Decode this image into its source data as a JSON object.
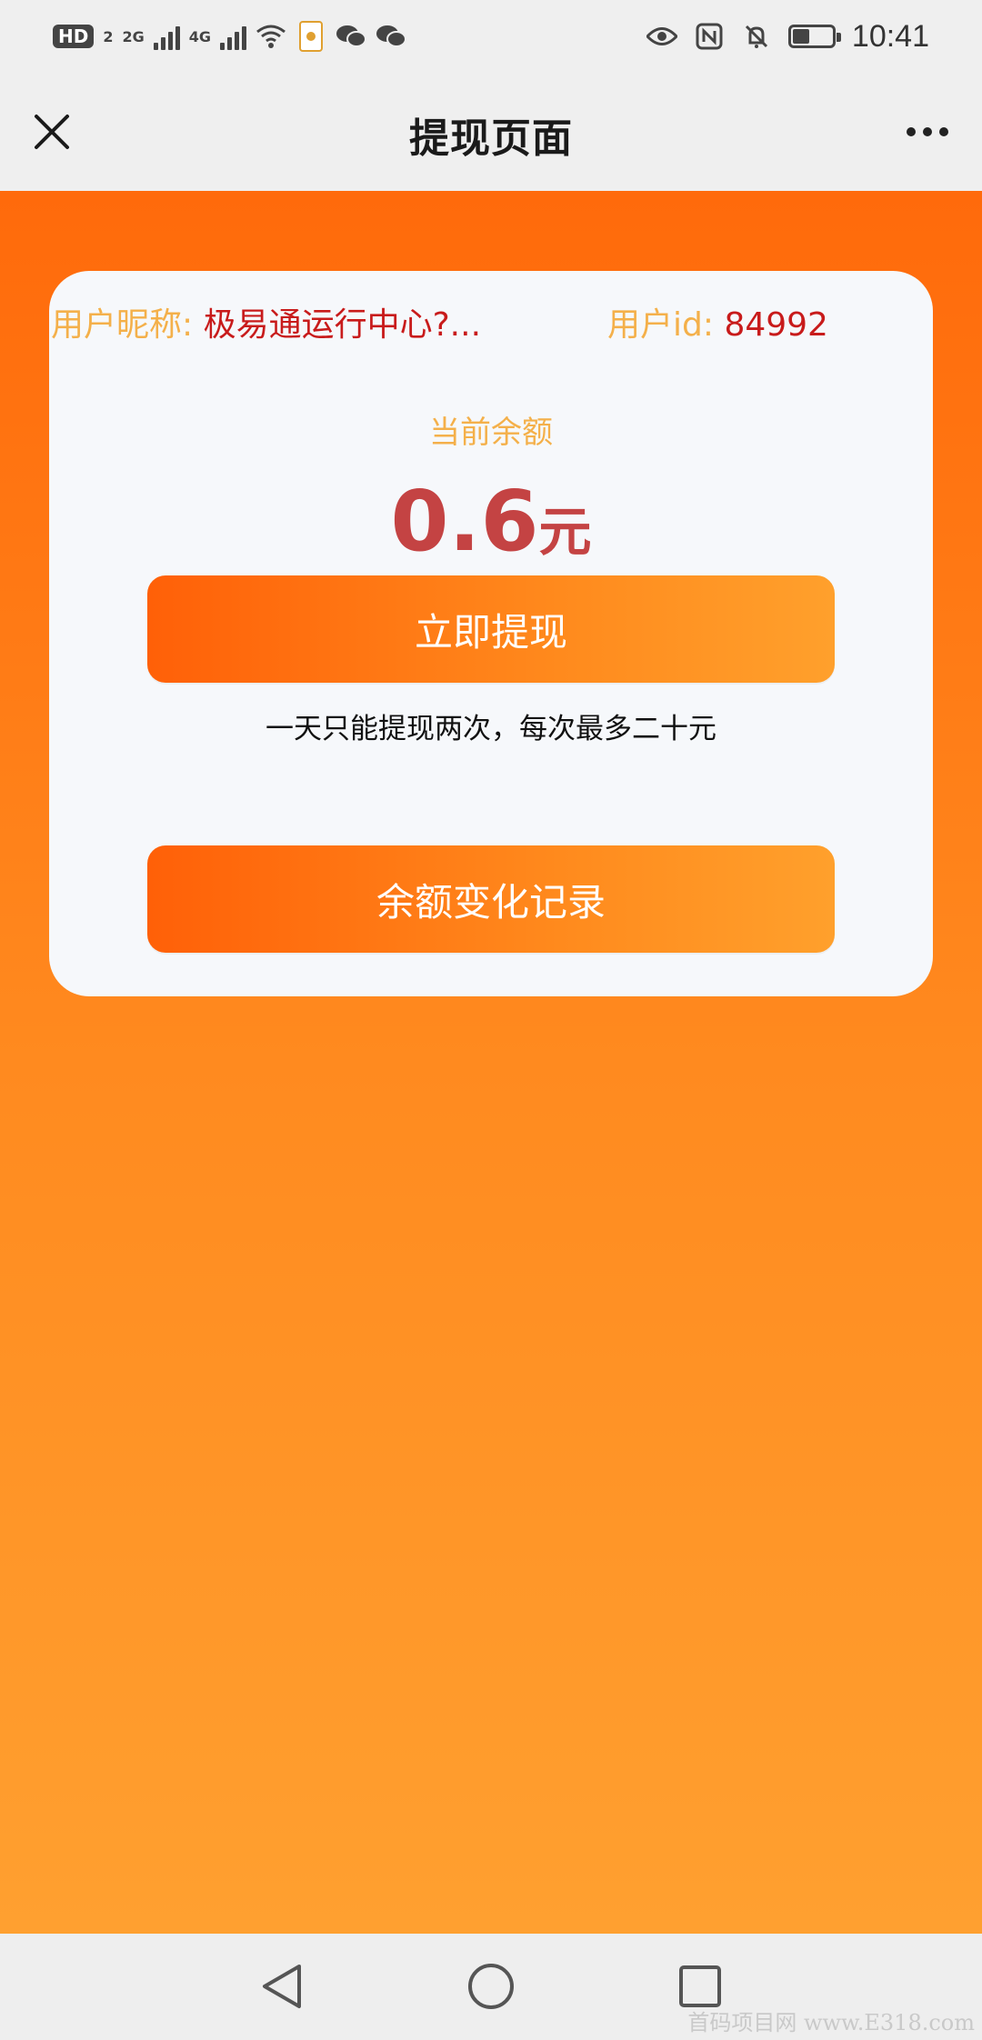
{
  "status_bar": {
    "hd_badge": "HD",
    "hd_sub": "2",
    "network_1": "2G",
    "network_2": "4G",
    "time": "10:41"
  },
  "nav": {
    "title": "提现页面"
  },
  "card": {
    "nickname_label": "用户昵称: ",
    "nickname_value": "极易通运行中心?...",
    "uid_label": "用户id: ",
    "uid_value": "84992",
    "balance_label": "当前余额",
    "balance_amount": "0.6",
    "balance_unit": "元",
    "withdraw_button": "立即提现",
    "withdraw_note": "一天只能提现两次，每次最多二十元",
    "history_button": "余额变化记录"
  },
  "watermark": "首码项目网 www.E318.com",
  "colors": {
    "orange_top": "#ff6a0b",
    "orange_bottom": "#ffa030",
    "label_gold": "#f4b04a",
    "value_red": "#c81b1b",
    "amount_red": "#c44343"
  },
  "icons": [
    "close-icon",
    "more-icon",
    "eye-icon",
    "nfc-icon",
    "bell-off-icon",
    "battery-icon",
    "wifi-icon",
    "wechat-icon",
    "back-icon",
    "home-icon",
    "recents-icon"
  ]
}
